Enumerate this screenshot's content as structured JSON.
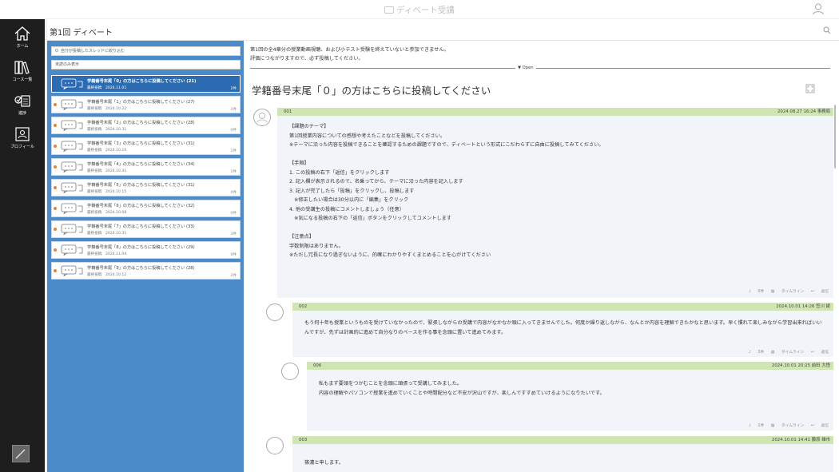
{
  "app": {
    "title": "ディベート受講"
  },
  "nav": [
    {
      "label": "ホーム",
      "icon": "home-icon"
    },
    {
      "label": "コース一覧",
      "icon": "books-icon"
    },
    {
      "label": "進捗",
      "icon": "progress-icon"
    },
    {
      "label": "プロフィール",
      "icon": "profile-icon"
    }
  ],
  "page": {
    "title": "第1回 ディベート"
  },
  "filters": {
    "own_threads": "自分が投稿したスレッドに絞り込む",
    "unread_only": "未読のみ表示"
  },
  "threads": [
    {
      "title": "学籍番号末尾「0」の方はこちらに投稿してください (21)",
      "date": "最終投稿　2024.11.01",
      "count": "2件",
      "active": true
    },
    {
      "title": "学籍番号末尾「1」の方はこちらに投稿してください (27)",
      "date": "最終投稿　2024.10.22",
      "count": "1件"
    },
    {
      "title": "学籍番号末尾「2」の方はこちらに投稿してください (28)",
      "date": "最終投稿　2024.10.31",
      "count": "0件"
    },
    {
      "title": "学籍番号末尾「3」の方はこちらに投稿してください (31)",
      "date": "最終投稿　2024.10.16",
      "count": "1件"
    },
    {
      "title": "学籍番号末尾「4」の方はこちらに投稿してください (34)",
      "date": "最終投稿　2024.10.31",
      "count": "1件"
    },
    {
      "title": "学籍番号末尾「5」の方はこちらに投稿してください (31)",
      "date": "最終投稿　2024.10.15",
      "count": "0件"
    },
    {
      "title": "学籍番号末尾「6」の方はこちらに投稿してください (32)",
      "date": "最終投稿　2024.10.08",
      "count": "0件"
    },
    {
      "title": "学籍番号末尾「7」の方はこちらに投稿してください (33)",
      "date": "最終投稿　2024.10.31",
      "count": "3件"
    },
    {
      "title": "学籍番号末尾「8」の方はこちらに投稿してください (29)",
      "date": "最終投稿　2024.11.04",
      "count": "0件"
    },
    {
      "title": "学籍番号末尾「9」の方はこちらに投稿してください (28)",
      "date": "最終投稿　2024.10.12",
      "count": "2件"
    }
  ],
  "main": {
    "notice_line1": "第1回の全4章分の授業動画視聴、および小テスト受験を終えていないと参加できません。",
    "notice_line2": "評価につながりますので、必ず投稿してください。",
    "open_label": "▼ Open",
    "thread_heading": "学籍番号末尾「０」の方はこちらに投稿してください"
  },
  "posts": [
    {
      "no": "001",
      "meta": "2024.08.27 16:24 事務局",
      "body": "【課題のテーマ】\n第1回授業内容についての感想や考えたことなどを投稿してください。\n※テーマに沿った内容を投稿できることを確認するための課題ですので、ディベートという形式にこだわらずに自由に投稿してみてください。\n\n【手順】\n1. この投稿の右下「返信」をクリックします\n2. 記入欄が表示されるので、名乗ってから、テーマに沿った内容を記入します\n3. 記入が完了したら「投稿」をクリックし、投稿します\n　※修正したい場合は30分以内に「編集」をクリック\n4. 他の受講生の投稿にコメントしましょう（任意）\n　※気になる投稿の右下の「返信」ボタンをクリックしてコメントします\n\n【注意点】\n字数制限はありません。\n※ただし冗長になり過ぎないように、的確にわかりやすくまとめることを心がけてください",
      "likes": "0件",
      "timeline": "タイムライン",
      "reply": "返信"
    },
    {
      "no": "002",
      "meta": "2024.10.01 14:26 笠川 綾",
      "body": "もう何十年も授業というものを受けていなかったので、緊張しながらの受講で内容がなかなか頭に入ってきませんでした。何度か繰り返しながら、なんとか内容を理解できたかなと思います。早く慣れて楽しみながら学習出来ればいいんですが、先ずは計画的に進めて自分なりのペースを作る事を念頭に置いて進めてみます。",
      "likes": "3件",
      "timeline": "タイムライン",
      "reply": "返信"
    },
    {
      "no": "006",
      "meta": "2024.10.01 20:25 前田 大悟",
      "body": "私もまず要領をつかむことを念頭に頑張って受講してみました。\n内容の理解やパソコンで授業を進めていくことや時間配分など不安が沢山ですが、楽しんですすめていけるようになりたいです。",
      "likes": "1件",
      "timeline": "タイムライン",
      "reply": "返信"
    },
    {
      "no": "003",
      "meta": "2024.10.01 14:41 藤原 雄市",
      "body": "篠濃と申します。",
      "likes": "",
      "timeline": "",
      "reply": ""
    }
  ]
}
